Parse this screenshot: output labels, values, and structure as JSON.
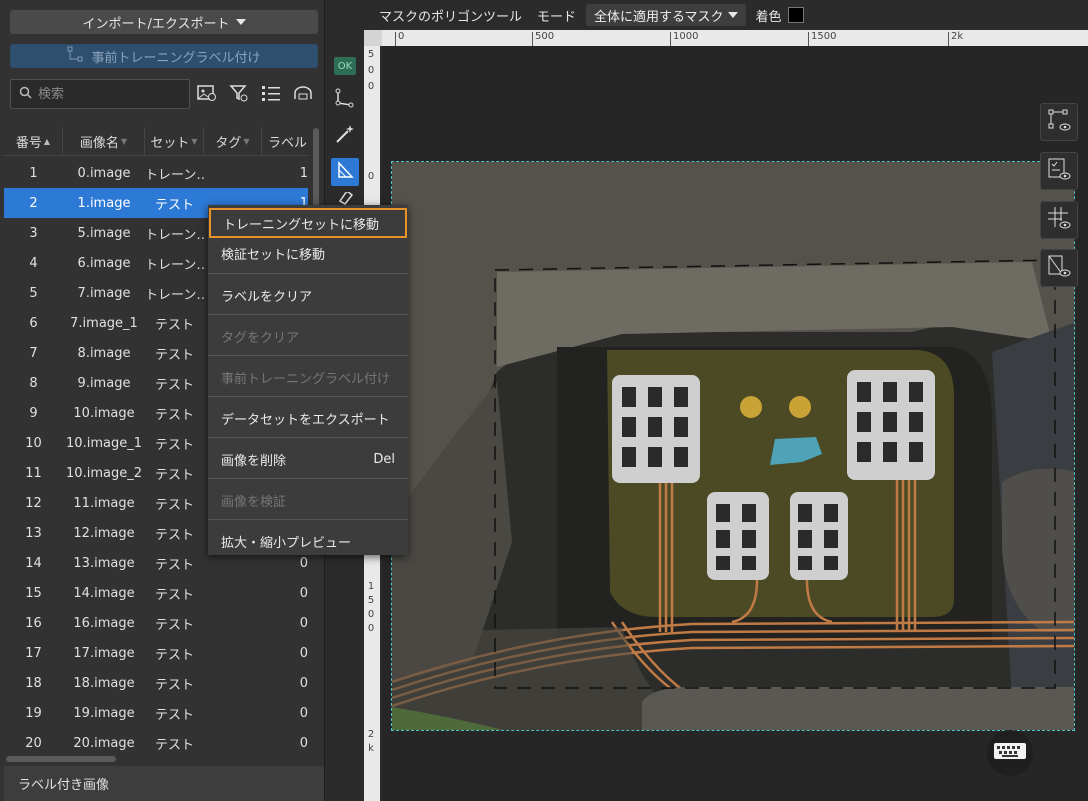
{
  "left_panel": {
    "import_export_label": "インポート/エクスポート",
    "pretrain_label": "事前トレーニングラベル付け",
    "search_placeholder": "検索",
    "columns": [
      "番号",
      "画像名",
      "セット",
      "タグ",
      "ラベル"
    ],
    "rows": [
      {
        "no": "1",
        "name": "0.image",
        "set": "トレーン…",
        "label": "1"
      },
      {
        "no": "2",
        "name": "1.image",
        "set": "テスト",
        "label": "1"
      },
      {
        "no": "3",
        "name": "5.image",
        "set": "トレーン…",
        "label": ""
      },
      {
        "no": "4",
        "name": "6.image",
        "set": "トレーン…",
        "label": ""
      },
      {
        "no": "5",
        "name": "7.image",
        "set": "トレーン…",
        "label": ""
      },
      {
        "no": "6",
        "name": "7.image_1",
        "set": "テスト",
        "label": ""
      },
      {
        "no": "7",
        "name": "8.image",
        "set": "テスト",
        "label": ""
      },
      {
        "no": "8",
        "name": "9.image",
        "set": "テスト",
        "label": ""
      },
      {
        "no": "9",
        "name": "10.image",
        "set": "テスト",
        "label": ""
      },
      {
        "no": "10",
        "name": "10.image_1",
        "set": "テスト",
        "label": ""
      },
      {
        "no": "11",
        "name": "10.image_2",
        "set": "テスト",
        "label": ""
      },
      {
        "no": "12",
        "name": "11.image",
        "set": "テスト",
        "label": ""
      },
      {
        "no": "13",
        "name": "12.image",
        "set": "テスト",
        "label": ""
      },
      {
        "no": "14",
        "name": "13.image",
        "set": "テスト",
        "label": "0"
      },
      {
        "no": "15",
        "name": "14.image",
        "set": "テスト",
        "label": "0"
      },
      {
        "no": "16",
        "name": "16.image",
        "set": "テスト",
        "label": "0"
      },
      {
        "no": "17",
        "name": "17.image",
        "set": "テスト",
        "label": "0"
      },
      {
        "no": "18",
        "name": "18.image",
        "set": "テスト",
        "label": "0"
      },
      {
        "no": "19",
        "name": "19.image",
        "set": "テスト",
        "label": "0"
      },
      {
        "no": "20",
        "name": "20.image",
        "set": "テスト",
        "label": "0"
      }
    ],
    "selected_row": 2,
    "footer_label": "ラベル付き画像"
  },
  "toolbar": {
    "tool_name": "マスクのポリゴンツール",
    "mode_label": "モード",
    "mode_value": "全体に適用するマスク",
    "color_label": "着色",
    "color_value": "#000000"
  },
  "tool_strip": {
    "ok_label": "OK"
  },
  "ruler": {
    "top_ticks": [
      "0",
      "500",
      "1000",
      "1500",
      "2k"
    ],
    "left_ticks": [
      "5",
      "0",
      "0",
      "0",
      "1",
      "5",
      "0",
      "0",
      "2",
      "k"
    ]
  },
  "context_menu": {
    "items": [
      {
        "label": "トレーニングセットに移動",
        "state": "highlighted",
        "shortcut": ""
      },
      {
        "label": "検証セットに移動",
        "state": "enabled",
        "shortcut": ""
      },
      {
        "label": "ラベルをクリア",
        "state": "enabled",
        "shortcut": ""
      },
      {
        "label": "タグをクリア",
        "state": "disabled",
        "shortcut": ""
      },
      {
        "label": "事前トレーニングラベル付け",
        "state": "disabled",
        "shortcut": ""
      },
      {
        "label": "データセットをエクスポート",
        "state": "enabled",
        "shortcut": ""
      },
      {
        "label": "画像を削除",
        "state": "enabled",
        "shortcut": "Del"
      },
      {
        "label": "画像を検証",
        "state": "disabled",
        "shortcut": ""
      },
      {
        "label": "拡大・縮小プレビュー",
        "state": "enabled",
        "shortcut": ""
      }
    ]
  },
  "colors": {
    "accent_blue": "#2d79d6",
    "highlight_orange": "#e7932a",
    "mask_outline": "#4fc3c3"
  },
  "icons": [
    "search-icon",
    "image-settings-icon",
    "filter-icon",
    "list-icon",
    "cloud-icon",
    "polygon-icon",
    "magic-wand-icon",
    "mask-tool-icon",
    "eraser-icon",
    "node-view-icon",
    "checklist-view-icon",
    "grid-view-icon",
    "mask-view-icon",
    "keyboard-icon"
  ]
}
